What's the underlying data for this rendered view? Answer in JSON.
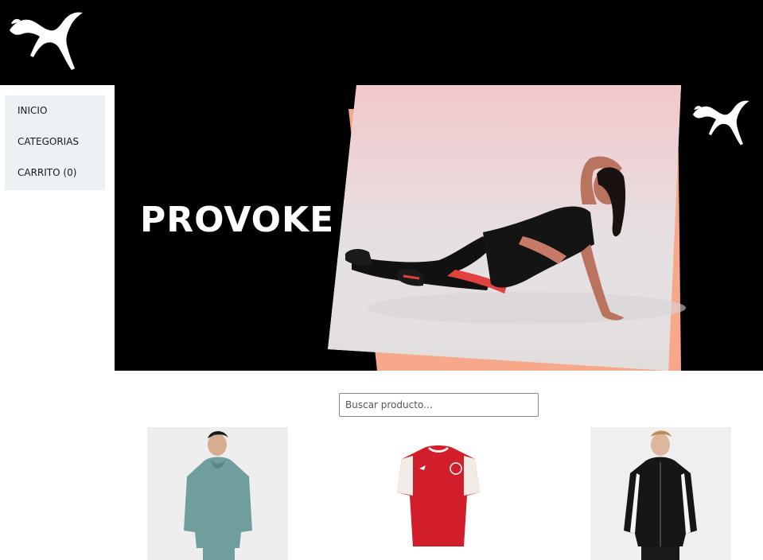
{
  "brand": {
    "logo_icon": "puma-cat-logo-icon",
    "colors": {
      "header_bg": "#000000",
      "nav_bg": "#ecf1f4",
      "accent_peach": "#f7a88a"
    }
  },
  "nav": {
    "items": [
      {
        "label": "INICIO"
      },
      {
        "label": "CATEGORIAS"
      },
      {
        "label": "CARRITO (0)"
      }
    ]
  },
  "hero": {
    "title": "PROVOKE",
    "image": "woman-in-sportswear-photo"
  },
  "search": {
    "placeholder": "Buscar producto..."
  },
  "products": [
    {
      "image": "teal-hoodie-photo"
    },
    {
      "image": "red-jersey-photo"
    },
    {
      "image": "black-track-jacket-photo"
    }
  ]
}
